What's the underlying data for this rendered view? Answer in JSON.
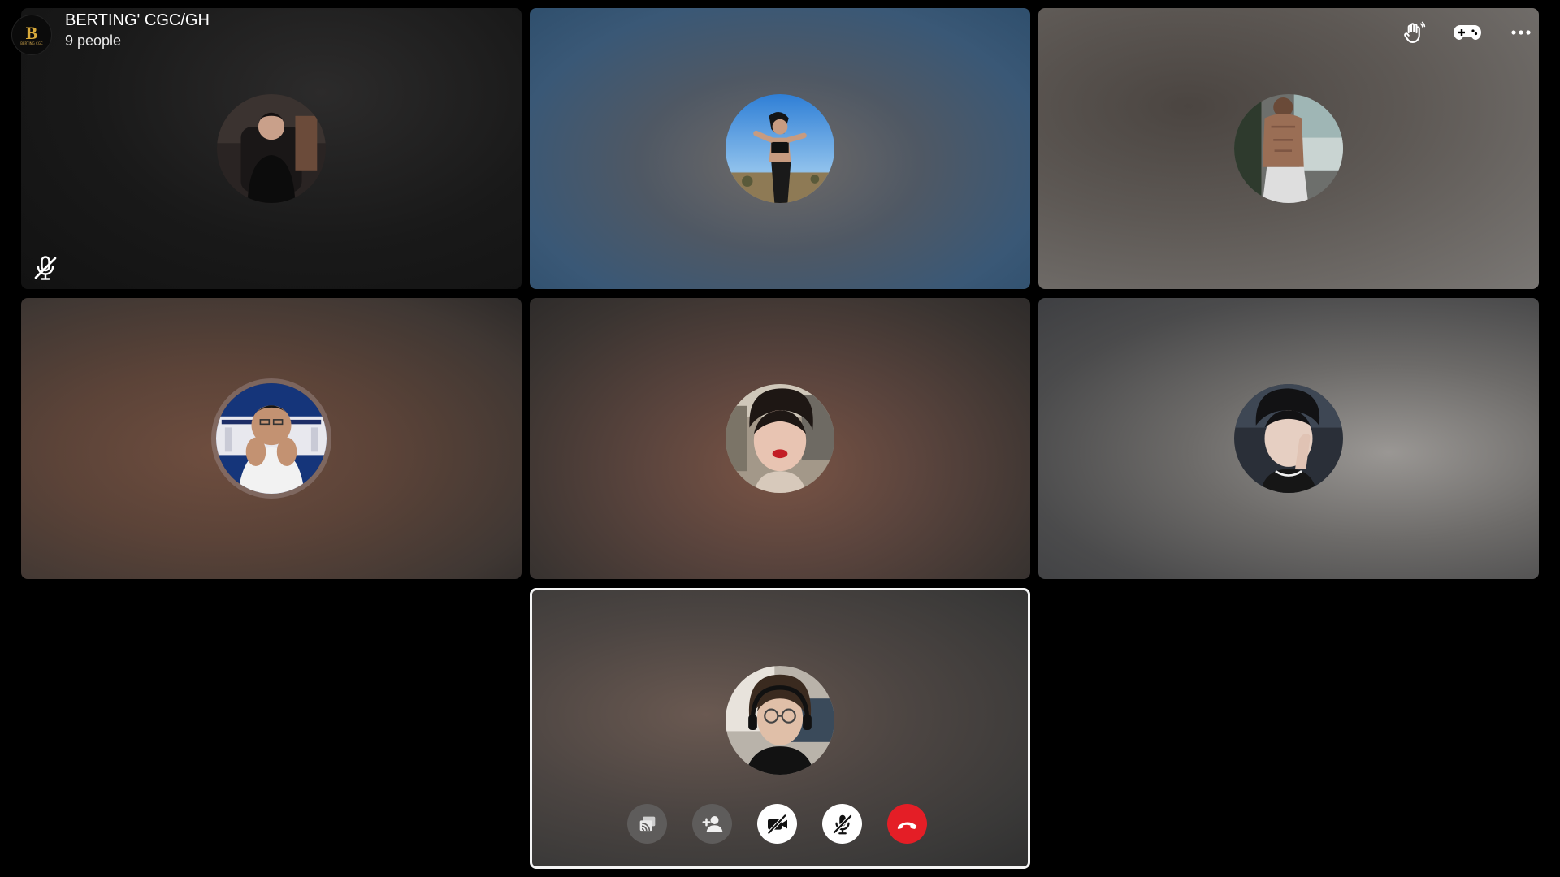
{
  "header": {
    "group_name": "BERTING' CGC/GH",
    "member_count": "9 people",
    "logo_letter": "B",
    "logo_small_text": "BERTING CGC"
  },
  "top_actions": [
    {
      "icon": "raise-hand-icon"
    },
    {
      "icon": "game-controller-icon"
    },
    {
      "icon": "more-options-icon"
    }
  ],
  "participants": [
    {
      "id": 1,
      "muted": true,
      "background": "dark"
    },
    {
      "id": 2,
      "muted": false,
      "background": "blue"
    },
    {
      "id": 3,
      "muted": false,
      "background": "grey"
    },
    {
      "id": 4,
      "muted": false,
      "background": "brown"
    },
    {
      "id": 5,
      "muted": false,
      "background": "brown"
    },
    {
      "id": 6,
      "muted": false,
      "background": "light-grey"
    },
    {
      "id": 7,
      "muted": false,
      "background": "self",
      "is_self": true
    }
  ],
  "controls": [
    {
      "icon": "share-screen-icon",
      "style": "grey"
    },
    {
      "icon": "add-person-icon",
      "style": "grey"
    },
    {
      "icon": "video-off-icon",
      "style": "white"
    },
    {
      "icon": "mic-off-icon",
      "style": "white"
    },
    {
      "icon": "end-call-icon",
      "style": "red"
    }
  ],
  "colors": {
    "end_call": "#e41e26",
    "logo_gold": "#d8a93a",
    "self_border": "#f4f4f4"
  }
}
